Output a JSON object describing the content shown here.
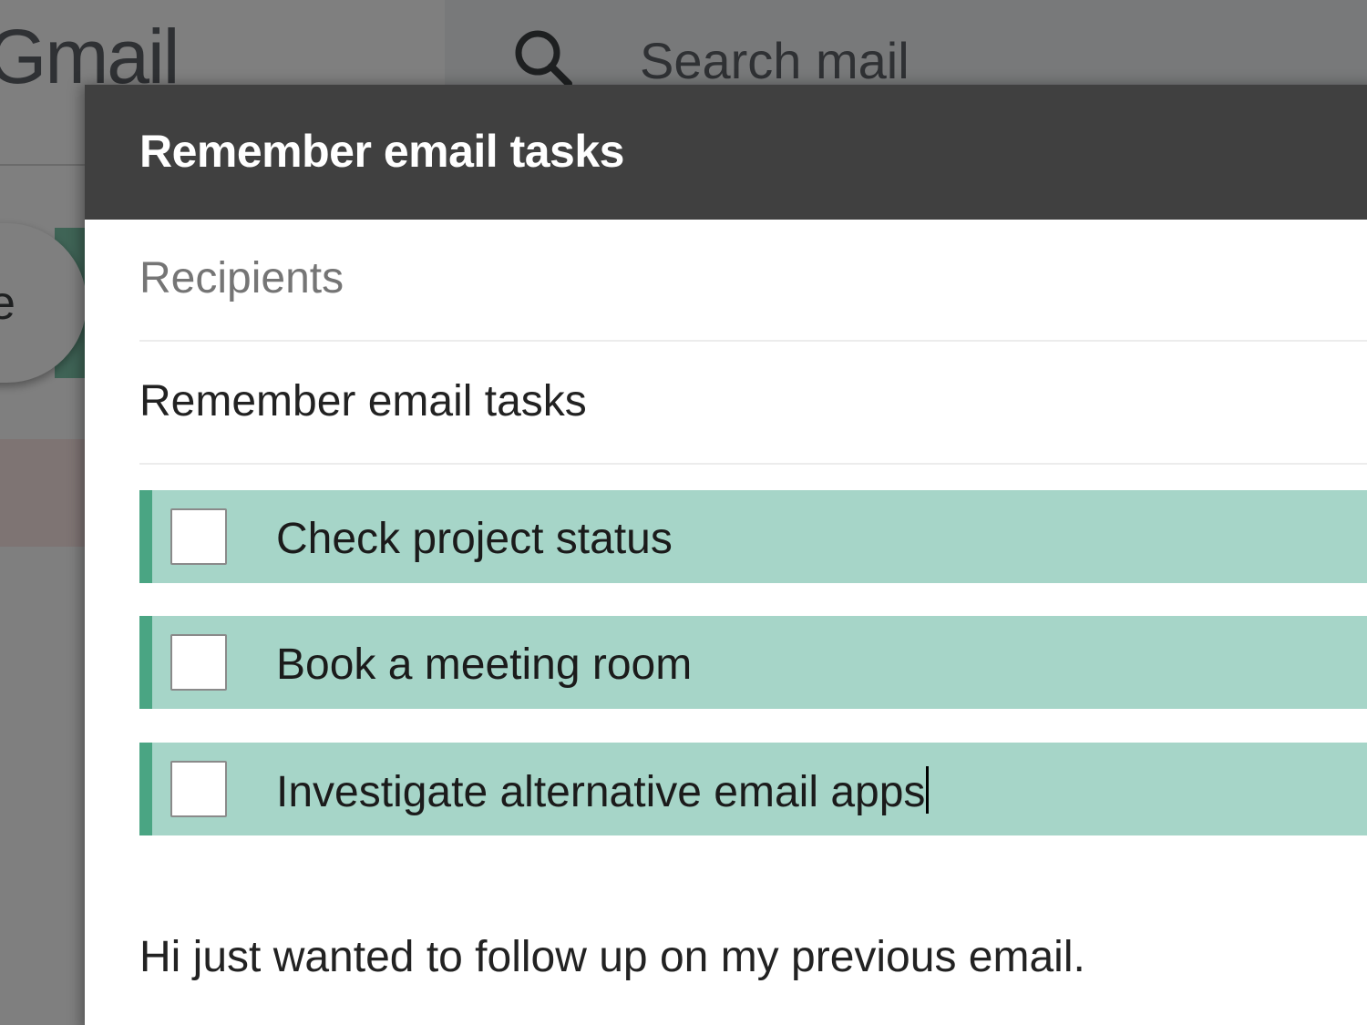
{
  "app": {
    "logo_text": "Gmail",
    "search_placeholder": "Search mail",
    "compose_label_partial": "e"
  },
  "compose": {
    "title": "Remember email tasks",
    "recipients_placeholder": "Recipients",
    "subject": "Remember email tasks",
    "tasks": [
      {
        "label": "Check project status",
        "checked": false
      },
      {
        "label": "Book a meeting room",
        "checked": false
      },
      {
        "label": "Investigate alternative email apps",
        "checked": false
      }
    ],
    "body": "Hi just wanted to follow up on my previous email."
  },
  "colors": {
    "task_highlight": "#a6d5c8",
    "task_accent": "#4aa583",
    "dialog_header": "#404040"
  },
  "icons": {
    "search": "search-icon"
  }
}
